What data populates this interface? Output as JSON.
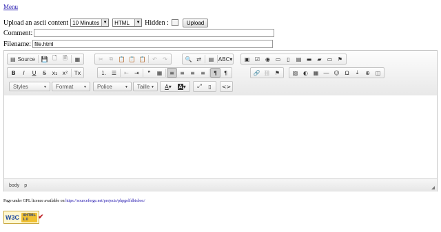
{
  "menu_link": "Menu",
  "upload_row": {
    "label": "Upload an ascii content",
    "duration": "10 Minutes",
    "format": "HTML",
    "hidden_label": "Hidden :",
    "upload_button": "Upload"
  },
  "comment_label": "Comment:",
  "comment_value": "",
  "filename_label": "Filename:",
  "filename_value": "file.html",
  "toolbar": {
    "source_label": "Source",
    "styles": "Styles",
    "format": "Format",
    "police": "Police",
    "taille": "Taille"
  },
  "status_path": [
    "body",
    "p"
  ],
  "footer": {
    "license_text": "Page under GPL licence available on",
    "license_link": "https://sourceforge.net/projects/phpgolfdbisbox/"
  },
  "badge": {
    "w3c": "W3C",
    "xhtml": "XHTML",
    "version": "1.0"
  }
}
